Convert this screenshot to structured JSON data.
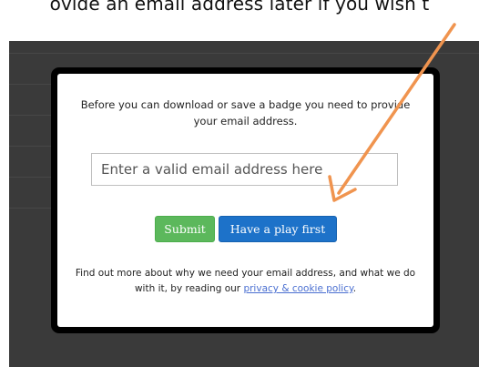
{
  "caption": {
    "text": "ovide an email address later if you wish t"
  },
  "modal": {
    "intro_line1": "Before you can download or save a badge you need to provide",
    "intro_line2": "your email address.",
    "email_placeholder": "Enter a valid email address here",
    "submit_label": "Submit",
    "play_label": "Have a play first",
    "footer_line1": "Find out more about why we need your email address, and what we do",
    "footer_line2_prefix": "with it, by reading our ",
    "policy_link_text": "privacy & cookie policy",
    "footer_line2_suffix": "."
  },
  "colors": {
    "backdrop": "#3a3a3a",
    "submit": "#5cb85c",
    "play": "#1d72c9",
    "arrow": "#f0944f",
    "link": "#4a6fd1"
  },
  "annotation": {
    "icon": "arrow-annotation-icon"
  }
}
